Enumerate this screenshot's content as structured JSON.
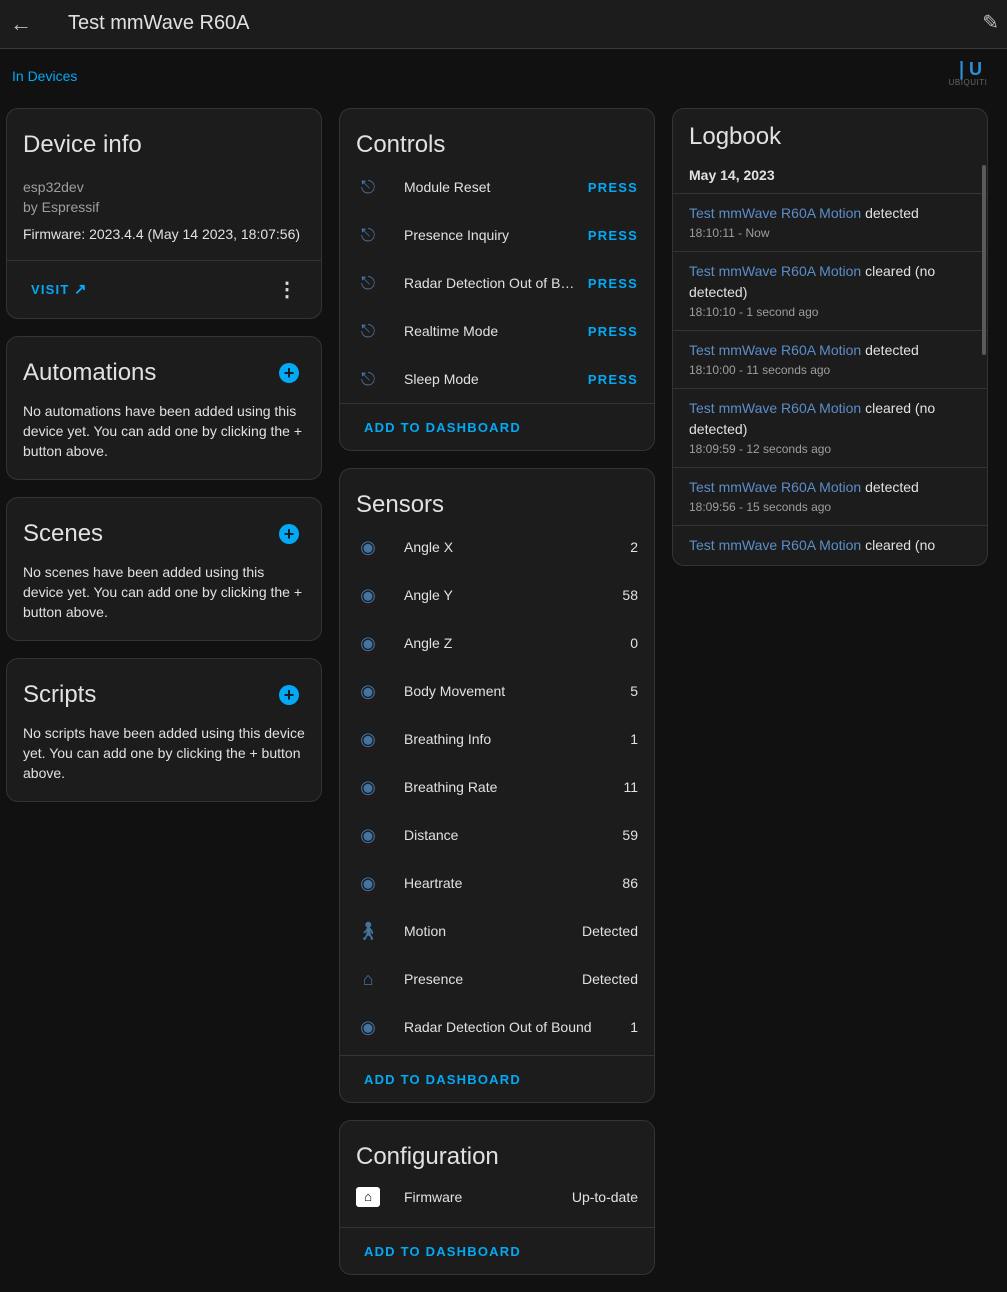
{
  "header": {
    "title": "Test mmWave R60A",
    "back_icon": "arrow-left-icon",
    "edit_icon": "pencil-icon"
  },
  "breadcrumb": "In Devices",
  "logo": "UBIQUITI",
  "device_info": {
    "title": "Device info",
    "model": "esp32dev",
    "manufacturer": "by Espressif",
    "firmware": "Firmware: 2023.4.4 (May 14 2023, 18:07:56)",
    "visit": "VISIT"
  },
  "automations": {
    "title": "Automations",
    "text": "No automations have been added using this device yet. You can add one by clicking the + button above."
  },
  "scenes": {
    "title": "Scenes",
    "text": "No scenes have been added using this device yet. You can add one by clicking the + button above."
  },
  "scripts": {
    "title": "Scripts",
    "text": "No scripts have been added using this device yet. You can add one by clicking the + button above."
  },
  "controls": {
    "title": "Controls",
    "items": [
      {
        "name": "Module Reset",
        "action": "PRESS"
      },
      {
        "name": "Presence Inquiry",
        "action": "PRESS"
      },
      {
        "name": "Radar Detection Out of Bound",
        "action": "PRESS"
      },
      {
        "name": "Realtime Mode",
        "action": "PRESS"
      },
      {
        "name": "Sleep Mode",
        "action": "PRESS"
      }
    ],
    "add": "ADD TO DASHBOARD"
  },
  "sensors": {
    "title": "Sensors",
    "items": [
      {
        "name": "Angle X",
        "value": "2",
        "icon": "eye"
      },
      {
        "name": "Angle Y",
        "value": "58",
        "icon": "eye"
      },
      {
        "name": "Angle Z",
        "value": "0",
        "icon": "eye"
      },
      {
        "name": "Body Movement",
        "value": "5",
        "icon": "eye"
      },
      {
        "name": "Breathing Info",
        "value": "1",
        "icon": "eye"
      },
      {
        "name": "Breathing Rate",
        "value": "11",
        "icon": "eye"
      },
      {
        "name": "Distance",
        "value": "59",
        "icon": "eye"
      },
      {
        "name": "Heartrate",
        "value": "86",
        "icon": "eye"
      },
      {
        "name": "Motion",
        "value": "Detected",
        "icon": "motion-sensor"
      },
      {
        "name": "Presence",
        "value": "Detected",
        "icon": "home"
      },
      {
        "name": "Radar Detection Out of Bound",
        "value": "1",
        "icon": "eye"
      }
    ],
    "add": "ADD TO DASHBOARD"
  },
  "configuration": {
    "title": "Configuration",
    "items": [
      {
        "name": "Firmware",
        "value": "Up-to-date",
        "icon": "firmware-chip"
      }
    ],
    "add": "ADD TO DASHBOARD"
  },
  "logbook": {
    "title": "Logbook",
    "date": "May 14, 2023",
    "entries": [
      {
        "entity": "Test mmWave R60A Motion",
        "state": " detected",
        "time": "18:10:11 - Now"
      },
      {
        "entity": "Test mmWave R60A Motion",
        "state": " cleared (no detected)",
        "time": "18:10:10 - 1 second ago"
      },
      {
        "entity": "Test mmWave R60A Motion",
        "state": " detected",
        "time": "18:10:00 - 11 seconds ago"
      },
      {
        "entity": "Test mmWave R60A Motion",
        "state": " cleared (no detected)",
        "time": "18:09:59 - 12 seconds ago"
      },
      {
        "entity": "Test mmWave R60A Motion",
        "state": " detected",
        "time": "18:09:56 - 15 seconds ago"
      },
      {
        "entity": "Test mmWave R60A Motion",
        "state": " cleared (no",
        "time": ""
      }
    ]
  },
  "colors": {
    "accent": "#03a9f4",
    "icon": "#44739e",
    "background": "#111111",
    "card": "#1c1c1c"
  }
}
